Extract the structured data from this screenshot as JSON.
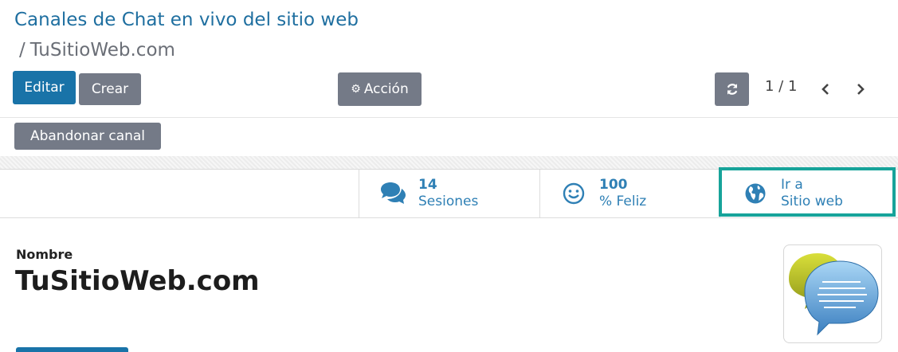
{
  "breadcrumb": {
    "parent": "Canales de Chat en vivo del sitio web",
    "separator": "/",
    "current": "TuSitioWeb.com"
  },
  "toolbar": {
    "edit_label": "Editar",
    "create_label": "Crear",
    "action_label": "Acción",
    "refresh_icon": "refresh-icon",
    "pager": "1 / 1"
  },
  "status_bar": {
    "leave_label": "Abandonar canal"
  },
  "stats": [
    {
      "icon": "comments-icon",
      "number": "14",
      "label": "Sesiones"
    },
    {
      "icon": "smile-icon",
      "number": "100",
      "label": "% Feliz"
    },
    {
      "icon": "globe-icon",
      "line1": "Ir a",
      "line2": "Sitio web"
    }
  ],
  "form": {
    "name_label": "Nombre",
    "name_value": "TuSitioWeb.com",
    "image_icon": "chat-bubbles-image"
  },
  "colors": {
    "primary": "#1973a8",
    "secondary": "#747a87",
    "link": "#2f80b5",
    "highlight": "#17a39a"
  }
}
